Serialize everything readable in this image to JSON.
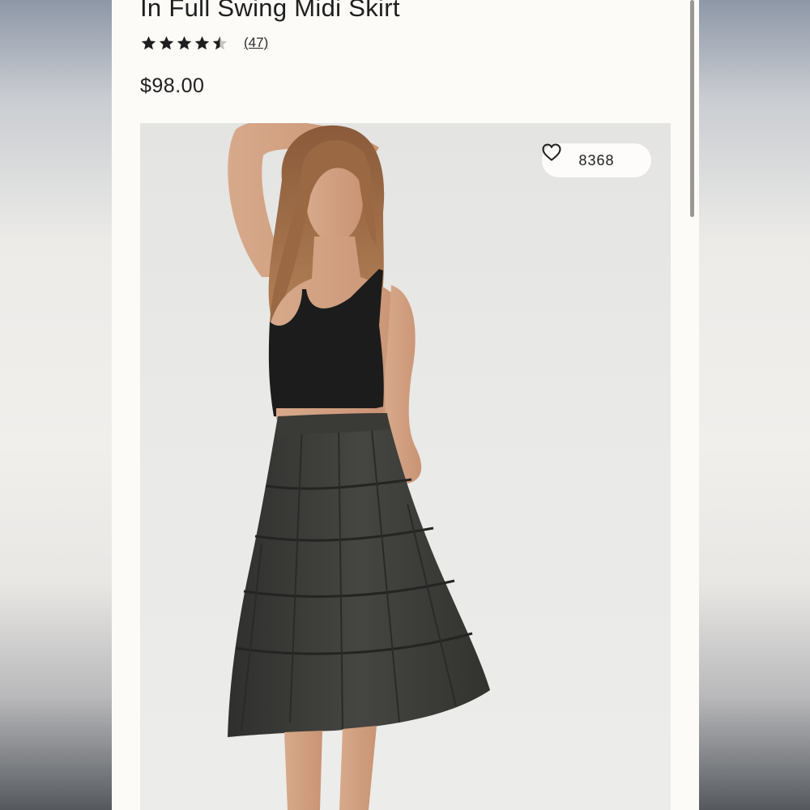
{
  "product": {
    "title": "In Full Swing Midi Skirt",
    "rating": 4.5,
    "rating_max": 5,
    "review_count": "(47)",
    "price": "$98.00"
  },
  "image": {
    "favorite_count": "8368",
    "favorite_icon": "heart-outline-icon"
  },
  "colors": {
    "text": "#1e1e1e",
    "panel_background": "#fdfbf8",
    "skirt": "#3b3b38",
    "top": "#1c1c1c"
  }
}
